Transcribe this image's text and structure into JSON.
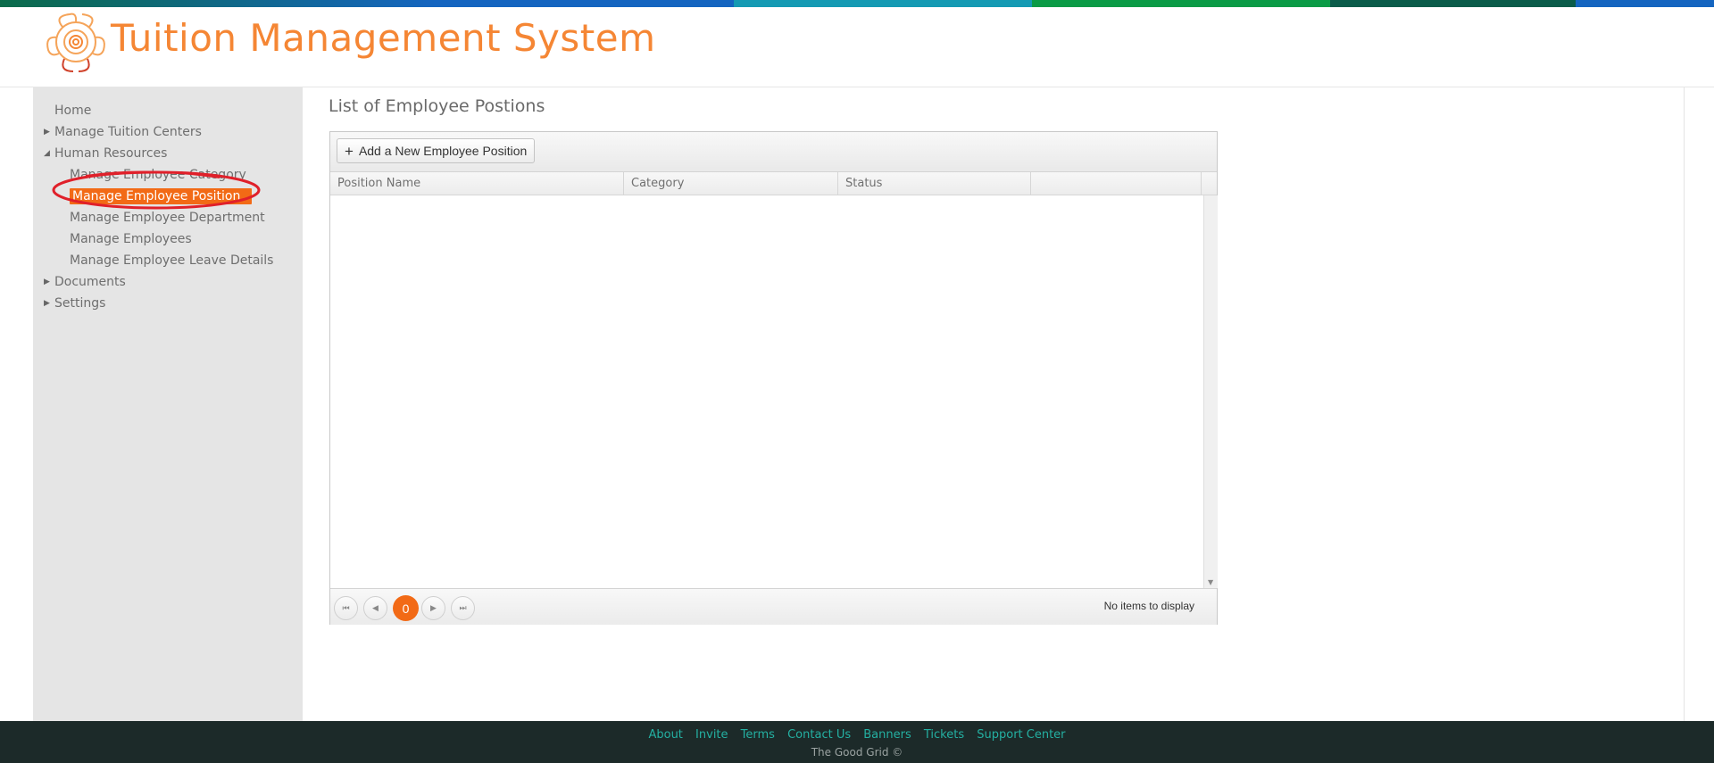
{
  "colors": {
    "accent": "#f26a16",
    "title": "#f58634",
    "footer_bg": "#1c2a29",
    "footer_link": "#24b0a2",
    "strip": [
      "#0b6b4a",
      "#1565c0",
      "#159ab3",
      "#0a9b46",
      "#0b5c4a",
      "#1565c0"
    ]
  },
  "header": {
    "logo_icon": "flower-logo-icon",
    "title": "Tuition Management System"
  },
  "sidebar": {
    "items": [
      {
        "label": "Home",
        "level": 0,
        "expander": ""
      },
      {
        "label": "Manage Tuition Centers",
        "level": 0,
        "expander": "▶"
      },
      {
        "label": "Human Resources",
        "level": 0,
        "expander": "◢"
      },
      {
        "label": "Manage Employee Category",
        "level": 1,
        "expander": ""
      },
      {
        "label": "Manage Employee Position",
        "level": 1,
        "expander": "",
        "active": true
      },
      {
        "label": "Manage Employee Department",
        "level": 1,
        "expander": ""
      },
      {
        "label": "Manage Employees",
        "level": 1,
        "expander": ""
      },
      {
        "label": "Manage Employee Leave Details",
        "level": 1,
        "expander": ""
      },
      {
        "label": "Documents",
        "level": 0,
        "expander": "▶"
      },
      {
        "label": "Settings",
        "level": 0,
        "expander": "▶"
      }
    ]
  },
  "main": {
    "heading": "List of Employee Postions",
    "toolbar": {
      "add_label": "Add a New Employee Position",
      "add_icon": "plus-icon"
    },
    "columns": [
      "Position Name",
      "Category",
      "Status",
      ""
    ],
    "rows": [],
    "pager": {
      "first_icon": "⏮",
      "prev_icon": "◀",
      "current_page": "0",
      "next_icon": "▶",
      "last_icon": "⏭",
      "info": "No items to display"
    }
  },
  "footer": {
    "links": [
      "About",
      "Invite",
      "Terms",
      "Contact Us",
      "Banners",
      "Tickets",
      "Support Center"
    ],
    "copyright": "The Good Grid ©"
  }
}
